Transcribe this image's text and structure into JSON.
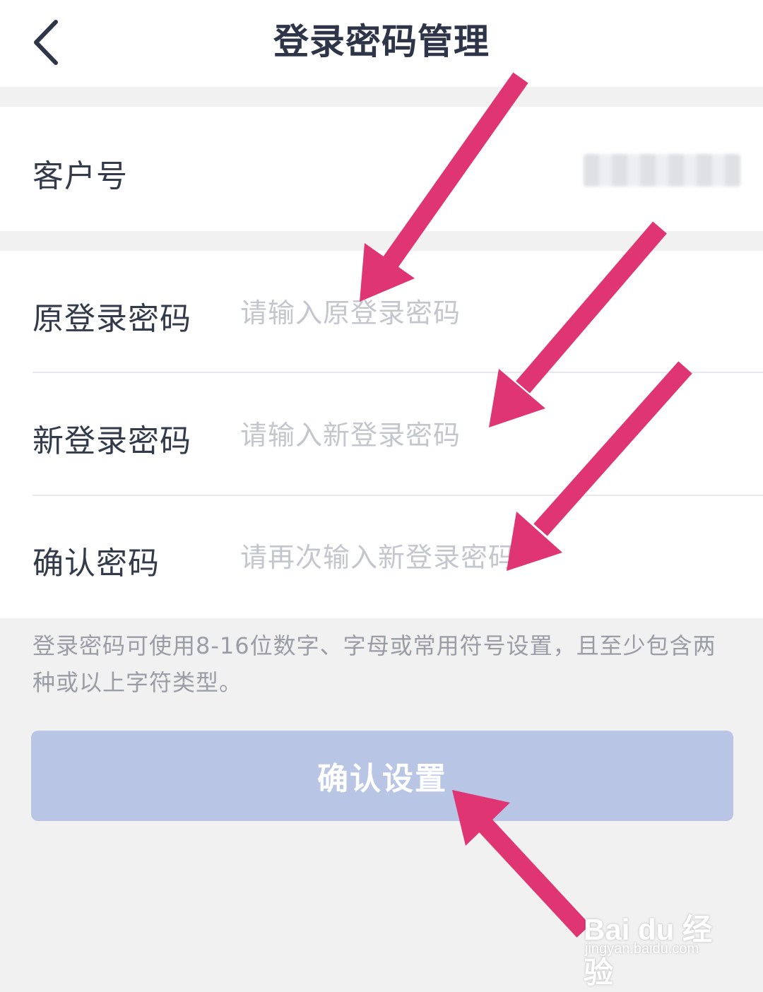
{
  "header": {
    "back_icon": "chevron-left-icon",
    "title": "登录密码管理"
  },
  "customer": {
    "label": "客户号",
    "value_masked": true
  },
  "form": {
    "old_password": {
      "label": "原登录密码",
      "placeholder": "请输入原登录密码",
      "value": ""
    },
    "new_password": {
      "label": "新登录密码",
      "placeholder": "请输入新登录密码",
      "value": ""
    },
    "confirm_password": {
      "label": "确认密码",
      "placeholder": "请再次输入新登录密码",
      "value": ""
    }
  },
  "hint": "登录密码可使用8-16位数字、字母或常用符号设置，且至少包含两种或以上字符类型。",
  "confirm_button": {
    "label": "确认设置"
  },
  "watermark": {
    "logo": "Bai du 经验",
    "url": "jingyan.baidu.com"
  },
  "colors": {
    "page_background": "#f1f1f1",
    "title_text": "#2f3548",
    "placeholder_text": "#c3c6cd",
    "hint_text": "#9a9da6",
    "button_disabled": "#b9c5e4",
    "annotation_arrow": "#df3572"
  }
}
